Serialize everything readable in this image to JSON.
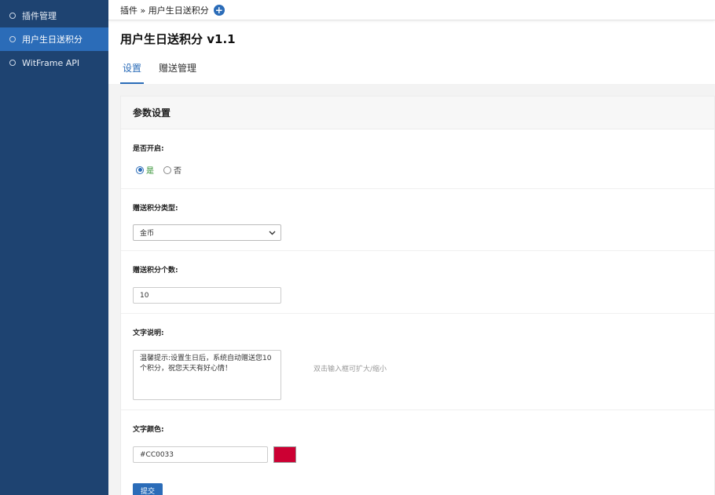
{
  "sidebar": {
    "items": [
      {
        "label": "插件管理",
        "active": false
      },
      {
        "label": "用户生日送积分",
        "active": true
      },
      {
        "label": "WitFrame API",
        "active": false
      }
    ]
  },
  "topbar": {
    "breadcrumb": "插件 » 用户生日送积分",
    "plus_icon": "+"
  },
  "page": {
    "title": "用户生日送积分 v1.1"
  },
  "tabs": [
    {
      "label": "设置",
      "active": true
    },
    {
      "label": "赠送管理",
      "active": false
    }
  ],
  "panel": {
    "header": "参数设置",
    "enable": {
      "label": "是否开启:",
      "yes": "是",
      "no": "否",
      "selected": "是"
    },
    "credit_type": {
      "label": "赠送积分类型:",
      "value": "金币"
    },
    "credit_count": {
      "label": "赠送积分个数:",
      "value": "10"
    },
    "description": {
      "label": "文字说明:",
      "value": "温馨提示:设置生日后，系统自动赠送您10个积分，祝您天天有好心情！",
      "hint": "双击输入框可扩大/缩小"
    },
    "text_color": {
      "label": "文字颜色:",
      "value": "#CC0033",
      "swatch": "#CC0033"
    },
    "submit_label": "提交"
  },
  "colors": {
    "sidebar_bg": "#1e4371",
    "sidebar_active": "#2b6cb8",
    "accent": "#2b6cb8"
  }
}
